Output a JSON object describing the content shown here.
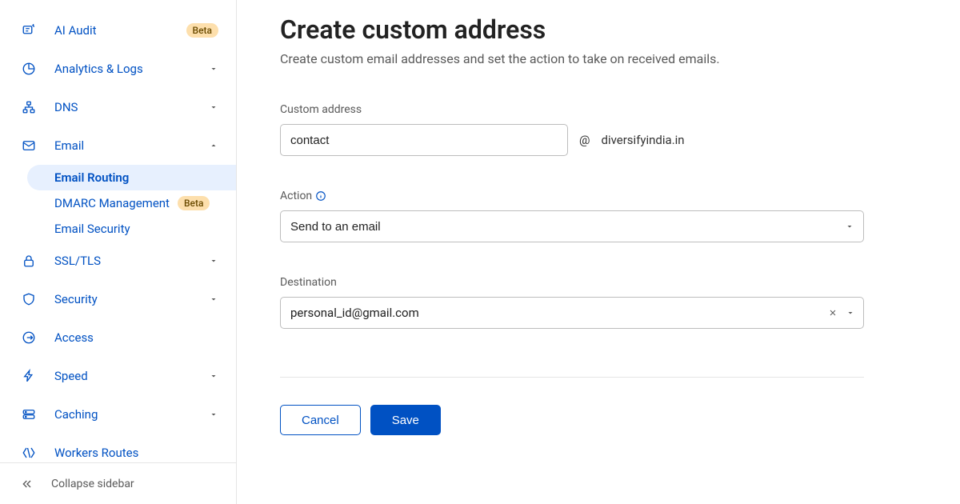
{
  "sidebar": {
    "items": [
      {
        "icon": "ai-audit-icon",
        "label": "AI Audit",
        "badge": "Beta",
        "hasChevron": false
      },
      {
        "icon": "analytics-icon",
        "label": "Analytics & Logs",
        "badge": null,
        "hasChevron": true
      },
      {
        "icon": "dns-icon",
        "label": "DNS",
        "badge": null,
        "hasChevron": true
      },
      {
        "icon": "email-icon",
        "label": "Email",
        "badge": null,
        "hasChevron": true,
        "expanded": true,
        "children": [
          {
            "label": "Email Routing",
            "active": true,
            "badge": null
          },
          {
            "label": "DMARC Management",
            "active": false,
            "badge": "Beta"
          },
          {
            "label": "Email Security",
            "active": false,
            "badge": null
          }
        ]
      },
      {
        "icon": "lock-icon",
        "label": "SSL/TLS",
        "badge": null,
        "hasChevron": true
      },
      {
        "icon": "shield-icon",
        "label": "Security",
        "badge": null,
        "hasChevron": true
      },
      {
        "icon": "access-icon",
        "label": "Access",
        "badge": null,
        "hasChevron": false
      },
      {
        "icon": "bolt-icon",
        "label": "Speed",
        "badge": null,
        "hasChevron": true
      },
      {
        "icon": "caching-icon",
        "label": "Caching",
        "badge": null,
        "hasChevron": true
      },
      {
        "icon": "workers-icon",
        "label": "Workers Routes",
        "badge": null,
        "hasChevron": false
      }
    ],
    "collapseLabel": "Collapse sidebar"
  },
  "form": {
    "title": "Create custom address",
    "subtitle": "Create custom email addresses and set the action to take on received emails.",
    "customAddress": {
      "label": "Custom address",
      "value": "contact",
      "at": "@",
      "domain": "diversifyindia.in"
    },
    "action": {
      "label": "Action",
      "selected": "Send to an email"
    },
    "destination": {
      "label": "Destination",
      "selected": "personal_id@gmail.com"
    },
    "buttons": {
      "cancel": "Cancel",
      "save": "Save"
    }
  }
}
